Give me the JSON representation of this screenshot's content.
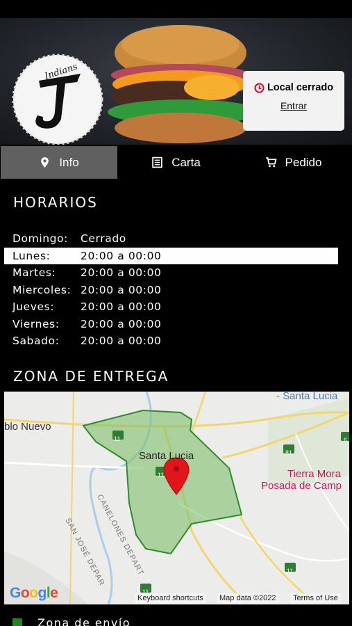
{
  "header": {
    "status": "Local cerrado",
    "action": "Entrar",
    "logo_text": "Indians"
  },
  "tabs": [
    {
      "label": "Info",
      "icon": "map-pin-icon",
      "active": true
    },
    {
      "label": "Carta",
      "icon": "menu-list-icon",
      "active": false
    },
    {
      "label": "Pedido",
      "icon": "cart-icon",
      "active": false
    }
  ],
  "hours": {
    "title": "HORARIOS",
    "rows": [
      {
        "day": "Domingo:",
        "hours": "Cerrado"
      },
      {
        "day": "Lunes:",
        "hours": "20:00 a 00:00"
      },
      {
        "day": "Martes:",
        "hours": "20:00 a 00:00"
      },
      {
        "day": "Miercoles:",
        "hours": "20:00 a 00:00"
      },
      {
        "day": "Jueves:",
        "hours": "20:00 a 00:00"
      },
      {
        "day": "Viernes:",
        "hours": "20:00 a 00:00"
      },
      {
        "day": "Sabado:",
        "hours": "20:00 a 00:00"
      }
    ],
    "highlighted_day": "Lunes:"
  },
  "delivery": {
    "title": "ZONA DE ENTREGA",
    "legend": "Zona de envío"
  },
  "map": {
    "labels": {
      "santa_lucia_top": "- Santa Lucia",
      "pueblo_nuevo": "blo Nuevo",
      "santa_lucia_center": "Santa Lucia",
      "tierra_mora": "Tierra Mora",
      "posada": "Posada de Camp",
      "canelones": "CANELONES DEPART",
      "san_jose": "SAN JOSÉ DEPAR"
    },
    "route_badges": [
      "11",
      "11",
      "81",
      "6",
      "11",
      "11"
    ],
    "footer": {
      "shortcuts": "Keyboard shortcuts",
      "map_data": "Map data ©2022",
      "terms": "Terms of Use"
    },
    "brand": "Google"
  },
  "colors": {
    "active_tab": "#5f605f",
    "status_icon": "#d0021b",
    "zone_fill": "#7fbf6a",
    "zone_stroke": "#2e8b2e",
    "pin": "#e0161b",
    "legend_swatch": "#1a8a1a"
  }
}
